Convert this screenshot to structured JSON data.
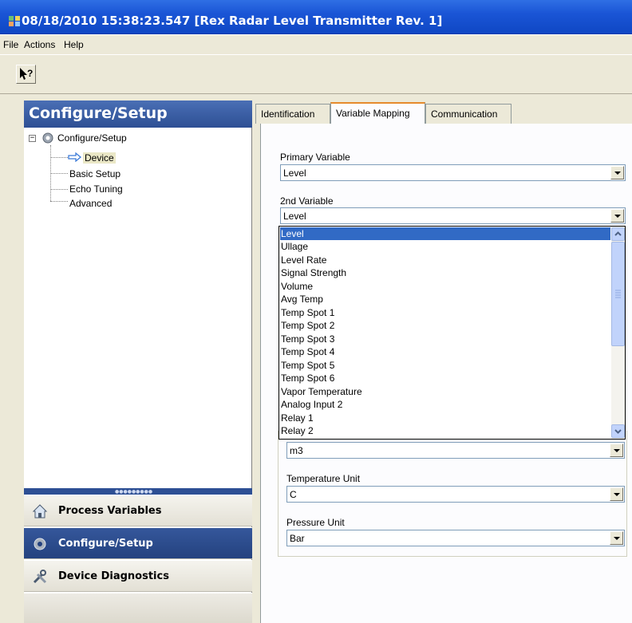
{
  "window": {
    "title": "08/18/2010 15:38:23.547 [Rex Radar Level Transmitter Rev. 1]"
  },
  "menu": {
    "items": [
      "File",
      "Actions",
      "Help"
    ]
  },
  "toolbar": {
    "help_icon": "whats-this-help-icon"
  },
  "left_panel": {
    "header": "Configure/Setup",
    "tree": {
      "root": "Configure/Setup",
      "children": [
        "Device",
        "Basic Setup",
        "Echo Tuning",
        "Advanced"
      ],
      "selected": "Device"
    },
    "nav_buttons": [
      {
        "label": "Process Variables",
        "icon": "home-icon"
      },
      {
        "label": "Configure/Setup",
        "icon": "gear-icon"
      },
      {
        "label": "Device Diagnostics",
        "icon": "tools-icon"
      }
    ]
  },
  "tabs": {
    "items": [
      "Identification",
      "Variable Mapping",
      "Communication"
    ],
    "active": "Variable Mapping"
  },
  "form": {
    "primary_variable": {
      "label": "Primary Variable",
      "value": "Level"
    },
    "second_variable": {
      "label": "2nd Variable",
      "value": "Level"
    },
    "volume_unit": {
      "value": "m3"
    },
    "temperature_unit": {
      "label": "Temperature Unit",
      "value": "C"
    },
    "pressure_unit": {
      "label": "Pressure Unit",
      "value": "Bar"
    }
  },
  "dropdown": {
    "options": [
      "Level",
      "Ullage",
      "Level Rate",
      "Signal Strength",
      "Volume",
      "Avg Temp",
      "Temp Spot 1",
      "Temp Spot 2",
      "Temp Spot 3",
      "Temp Spot 4",
      "Temp Spot 5",
      "Temp Spot 6",
      "Vapor Temperature",
      "Analog Input 2",
      "Relay 1",
      "Relay 2"
    ],
    "selected": "Level"
  },
  "colors": {
    "title_bar": "#1a55d6",
    "panel_header": "#2d4f94",
    "selection": "#316ac5",
    "tab_accent": "#e68b2c"
  }
}
